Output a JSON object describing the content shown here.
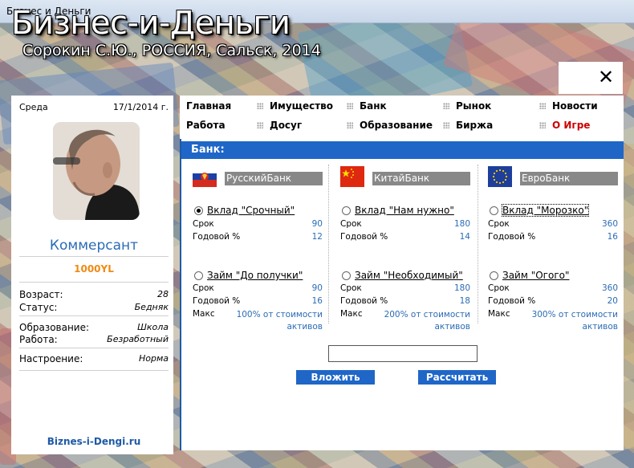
{
  "window": {
    "title": "Бизнес и Деньги"
  },
  "header": {
    "title": "Бизнес-и-Деньги",
    "subtitle": "Сорокин С.Ю., РОССИЯ, Сальск, 2014"
  },
  "close_label": "✕",
  "profile": {
    "day": "Среда",
    "date": "17/1/2014 г.",
    "rank": "Коммерсант",
    "money": "1000YL",
    "stats": [
      {
        "label": "Возраст:",
        "value": "28"
      },
      {
        "label": "Статус:",
        "value": "Бедняк"
      },
      {
        "label": "Образование:",
        "value": "Школа"
      },
      {
        "label": "Работа:",
        "value": "Безработный"
      },
      {
        "label": "Настроение:",
        "value": "Норма"
      }
    ],
    "site": "Biznes-i-Dengi.ru"
  },
  "nav": [
    {
      "label": "Главная"
    },
    {
      "label": "Имущество"
    },
    {
      "label": "Банк"
    },
    {
      "label": "Рынок"
    },
    {
      "label": "Новости"
    },
    {
      "label": "Работа"
    },
    {
      "label": "Досуг"
    },
    {
      "label": "Образование"
    },
    {
      "label": "Биржа"
    },
    {
      "label": "О Игре"
    }
  ],
  "bank": {
    "title": "Банк:",
    "banks": [
      {
        "name": "РусскийБанк",
        "flag": "russia-flag",
        "deposit": {
          "title": "Вклад \"Срочный\"",
          "selected": true,
          "term_label": "Срок",
          "term": "90",
          "rate_label": "Годовой %",
          "rate": "12"
        },
        "loan": {
          "title": "Займ \"До получки\"",
          "term_label": "Срок",
          "term": "90",
          "rate_label": "Годовой %",
          "rate": "16",
          "max_label": "Макс",
          "max": "100% от стоимости активов"
        }
      },
      {
        "name": "КитайБанк",
        "flag": "china-flag",
        "deposit": {
          "title": "Вклад \"Нам нужно\"",
          "selected": false,
          "term_label": "Срок",
          "term": "180",
          "rate_label": "Годовой %",
          "rate": "14"
        },
        "loan": {
          "title": "Займ \"Необходимый\"",
          "term_label": "Срок",
          "term": "180",
          "rate_label": "Годовой %",
          "rate": "18",
          "max_label": "Макс",
          "max": "200% от стоимости активов"
        }
      },
      {
        "name": "ЕвроБанк",
        "flag": "eu-flag",
        "deposit": {
          "title": "Вклад \"Морозко\"",
          "selected": false,
          "term_label": "Срок",
          "term": "360",
          "rate_label": "Годовой %",
          "rate": "16"
        },
        "loan": {
          "title": "Займ \"Огого\"",
          "term_label": "Срок",
          "term": "360",
          "rate_label": "Годовой %",
          "rate": "20",
          "max_label": "Макс",
          "max": "300% от стоимости активов"
        }
      }
    ],
    "amount_value": "",
    "invest_label": "Вложить",
    "calculate_label": "Рассчитать"
  },
  "colors": {
    "accent": "#1f66c7",
    "link": "#2b6cb5",
    "money": "#f08a14",
    "red_nav": "#cc0000"
  }
}
